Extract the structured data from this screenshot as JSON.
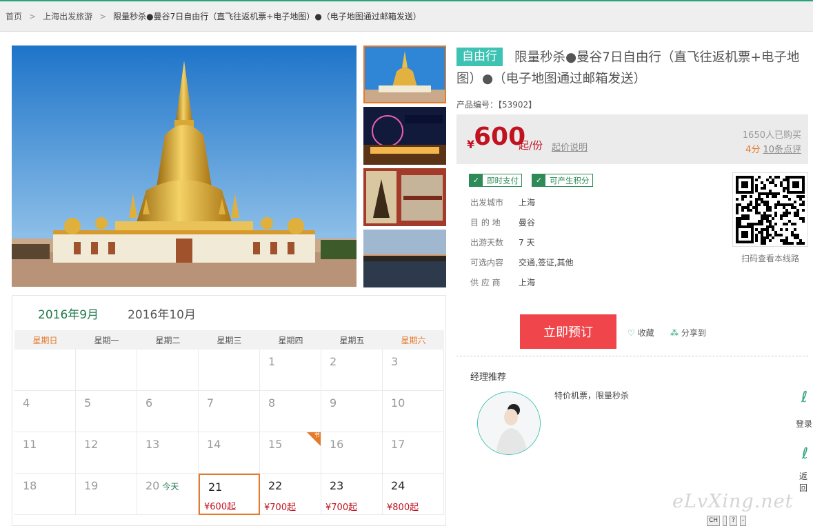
{
  "breadcrumb": {
    "home": "首页",
    "category": "上海出发旅游",
    "current": "限量秒杀●曼谷7日自由行（直飞往返机票+电子地图）●（电子地图通过邮箱发送）"
  },
  "product": {
    "tag": "自由行",
    "title": "限量秒杀●曼谷7日自由行（直飞往返机票+电子地图）●（电子地图通过邮箱发送）",
    "code_label": "产品编号：【53902】",
    "price_currency": "¥",
    "price_value": "600",
    "price_unit": "起/份",
    "price_explain": "起价说明",
    "bought": "1650人已购买",
    "score": "4分",
    "reviews": "10条点评"
  },
  "badges": {
    "instant_pay": "即时支付",
    "points": "可产生积分"
  },
  "info": [
    {
      "key": "出发城市",
      "value": "上海"
    },
    {
      "key": "目 的 地",
      "value": "曼谷"
    },
    {
      "key": "出游天数",
      "value": "7 天"
    },
    {
      "key": "可选内容",
      "value": "交通,签证,其他"
    },
    {
      "key": "供 应 商",
      "value": "上海"
    }
  ],
  "qr_caption": "扫码查看本线路",
  "actions": {
    "book": "立即预订",
    "favorite": "收藏",
    "share": "分享到"
  },
  "manager": {
    "title": "经理推荐",
    "text": "特价机票，限量秒杀"
  },
  "side": {
    "login": "登录",
    "back": "返回"
  },
  "watermark": "eLvXing.net",
  "calendar": {
    "tabs": [
      "2016年9月",
      "2016年10月"
    ],
    "weekdays": [
      "星期日",
      "星期一",
      "星期二",
      "星期三",
      "星期四",
      "星期五",
      "星期六"
    ],
    "today_label": "今天",
    "holiday_mark": "节",
    "rows": [
      [
        {
          "d": ""
        },
        {
          "d": ""
        },
        {
          "d": ""
        },
        {
          "d": ""
        },
        {
          "d": "1"
        },
        {
          "d": "2"
        },
        {
          "d": "3"
        }
      ],
      [
        {
          "d": "4"
        },
        {
          "d": "5"
        },
        {
          "d": "6"
        },
        {
          "d": "7"
        },
        {
          "d": "8"
        },
        {
          "d": "9"
        },
        {
          "d": "10"
        }
      ],
      [
        {
          "d": "11"
        },
        {
          "d": "12"
        },
        {
          "d": "13"
        },
        {
          "d": "14"
        },
        {
          "d": "15",
          "holiday": true
        },
        {
          "d": "16"
        },
        {
          "d": "17"
        }
      ],
      [
        {
          "d": "18"
        },
        {
          "d": "19"
        },
        {
          "d": "20",
          "today": true
        },
        {
          "d": "21",
          "price": "¥600起",
          "selected": true
        },
        {
          "d": "22",
          "price": "¥700起"
        },
        {
          "d": "23",
          "price": "¥700起"
        },
        {
          "d": "24",
          "price": "¥800起"
        }
      ]
    ]
  },
  "tray": [
    "CH",
    "",
    "?",
    "-"
  ],
  "colors": {
    "accent_green": "#2e8b57",
    "tag_teal": "#3ec2b3",
    "price_red": "#c1121f",
    "book_red": "#f0464b",
    "orange": "#e5792a"
  }
}
